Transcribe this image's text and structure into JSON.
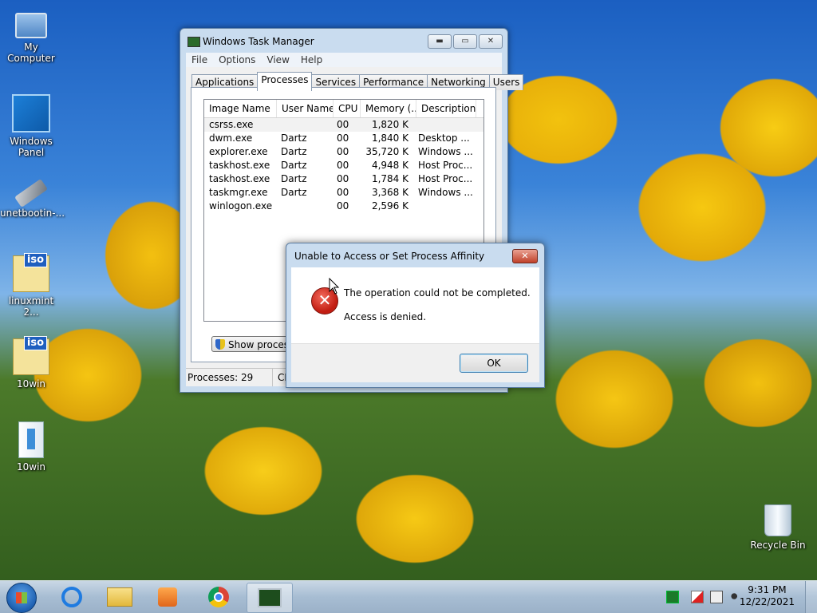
{
  "desktop": {
    "icons": [
      {
        "label": "My Computer",
        "icon": "computer-icon"
      },
      {
        "label": "Windows Panel",
        "icon": "windows-panel-icon"
      },
      {
        "label": "unetbootin-...",
        "icon": "usb-drive-icon"
      },
      {
        "label": "linuxmint 2...",
        "icon": "iso-file-icon"
      },
      {
        "label": "10win",
        "icon": "iso-file-icon"
      },
      {
        "label": "10win",
        "icon": "book-folder-icon"
      },
      {
        "label": "Recycle Bin",
        "icon": "recycle-bin-icon"
      }
    ]
  },
  "task_manager": {
    "title": "Windows Task Manager",
    "controls": {
      "minimize": "▬",
      "maximize": "▭",
      "close": "✕"
    },
    "menu": [
      "File",
      "Options",
      "View",
      "Help"
    ],
    "tabs": [
      "Applications",
      "Processes",
      "Services",
      "Performance",
      "Networking",
      "Users"
    ],
    "active_tab": "Processes",
    "columns": [
      "Image Name",
      "User Name",
      "CPU",
      "Memory (...",
      "Description"
    ],
    "rows": [
      {
        "name": "csrss.exe",
        "user": "",
        "cpu": "00",
        "mem": "1,820 K",
        "desc": ""
      },
      {
        "name": "dwm.exe",
        "user": "Dartz",
        "cpu": "00",
        "mem": "1,840 K",
        "desc": "Desktop ..."
      },
      {
        "name": "explorer.exe",
        "user": "Dartz",
        "cpu": "00",
        "mem": "35,720 K",
        "desc": "Windows ..."
      },
      {
        "name": "taskhost.exe",
        "user": "Dartz",
        "cpu": "00",
        "mem": "4,948 K",
        "desc": "Host Proc..."
      },
      {
        "name": "taskhost.exe",
        "user": "Dartz",
        "cpu": "00",
        "mem": "1,784 K",
        "desc": "Host Proc..."
      },
      {
        "name": "taskmgr.exe",
        "user": "Dartz",
        "cpu": "00",
        "mem": "3,368 K",
        "desc": "Windows ..."
      },
      {
        "name": "winlogon.exe",
        "user": "",
        "cpu": "00",
        "mem": "2,596 K",
        "desc": ""
      }
    ],
    "show_processes_button": "Show processes",
    "status": {
      "processes": "Processes: 29",
      "cpu": "CP"
    }
  },
  "error_dialog": {
    "title": "Unable to Access or Set Process Affinity",
    "close": "✕",
    "message": "The operation could not be completed.",
    "detail": "Access is denied.",
    "ok_label": "OK",
    "icon": "error-icon"
  },
  "taskbar": {
    "pinned": [
      "internet-explorer-icon",
      "file-explorer-icon",
      "media-player-icon",
      "chrome-icon",
      "task-manager-icon"
    ],
    "clock": {
      "time": "9:31 PM",
      "date": "12/22/2021"
    }
  }
}
